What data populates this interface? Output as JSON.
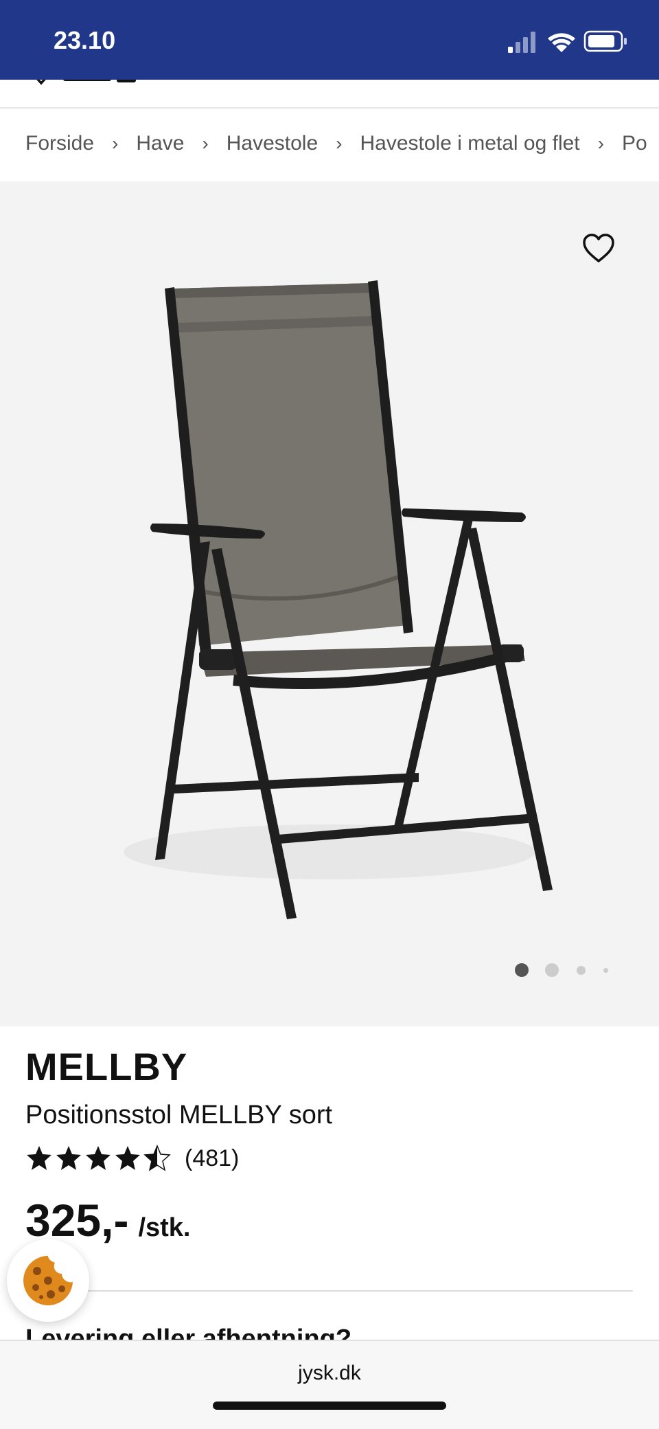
{
  "status_bar": {
    "time": "23.10",
    "background": "#21388a",
    "icons": [
      "cellular-signal-icon",
      "wifi-icon",
      "battery-icon"
    ]
  },
  "breadcrumb": {
    "items": [
      "Forside",
      "Have",
      "Havestole",
      "Havestole i metal og flet",
      "Po"
    ],
    "separator": "›"
  },
  "gallery": {
    "background": "#f3f3f3",
    "favorite_icon": "heart-outline-icon",
    "image_icon": "garden-chair-image",
    "slide_count": 4,
    "active_slide": 1
  },
  "product": {
    "brand": "MELLBY",
    "name": "Positionsstol MELLBY sort",
    "rating": 4.5,
    "rating_max": 5,
    "review_count": "(481)",
    "price": "325,-",
    "unit": "/stk.",
    "next_heading": "Levering eller afhentning?"
  },
  "cookie_button": {
    "icon": "cookie-icon"
  },
  "browser": {
    "url": "jysk.dk"
  }
}
